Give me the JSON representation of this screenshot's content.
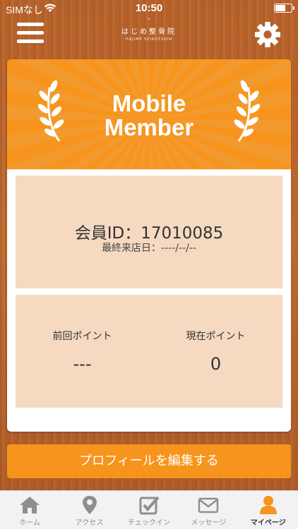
{
  "status_bar": {
    "carrier": "SIMなし",
    "time": "10:50"
  },
  "header": {
    "logo_mark": "ᵕ",
    "logo_japanese": "はじめ整骨院",
    "logo_english": "HAJIME SEIKOTSUIN",
    "menu_icon": "hamburger-icon",
    "settings_icon": "gear-icon"
  },
  "card": {
    "banner_title_line1": "Mobile",
    "banner_title_line2": "Member",
    "member_id": "会員ID：17010085",
    "last_visit": "最終来店日：----/--/--",
    "previous_points_label": "前回ポイント",
    "previous_points_value": "---",
    "current_points_label": "現在ポイント",
    "current_points_value": "0"
  },
  "profile_button_label": "プロフィールを編集する",
  "tabs": [
    {
      "label": "ホーム",
      "icon": "home-icon"
    },
    {
      "label": "アクセス",
      "icon": "location-pin-icon"
    },
    {
      "label": "チェックイン",
      "icon": "checkbox-icon"
    },
    {
      "label": "メッセージ",
      "icon": "envelope-icon"
    },
    {
      "label": "マイページ",
      "icon": "person-icon"
    }
  ],
  "colors": {
    "accent": "#f7941d",
    "panel": "#f5d9c0",
    "wood": "#b8622a"
  }
}
